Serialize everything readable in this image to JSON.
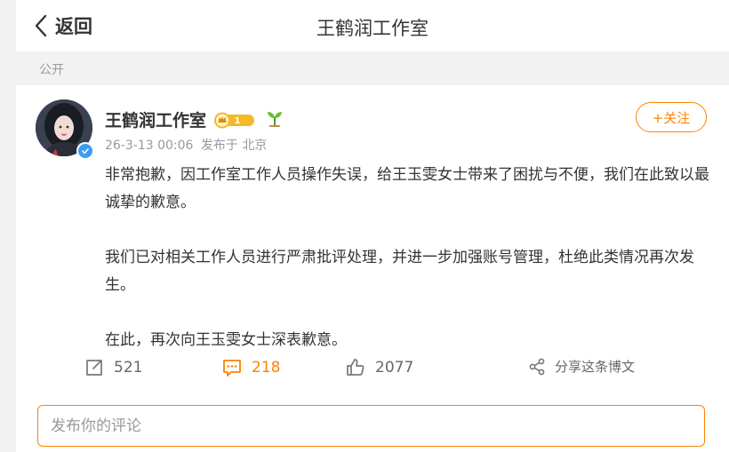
{
  "topbar": {
    "back_label": "返回",
    "title": "王鹤润工作室"
  },
  "visibility_label": "公开",
  "post": {
    "author_name": "王鹤润工作室",
    "vip_level": "1",
    "time": "26-3-13 00:06",
    "source": "发布于 北京",
    "follow_label": "+关注",
    "paragraphs": [
      "非常抱歉，因工作室工作人员操作失误，给王玉雯女士带来了困扰与不便，我们在此致以最诚挚的歉意。",
      "我们已对相关工作人员进行严肃批评处理，并进一步加强账号管理，杜绝此类情况再次发生。",
      "在此，再次向王玉雯女士深表歉意。"
    ]
  },
  "actions": {
    "repost_count": "521",
    "comment_count": "218",
    "like_count": "2077",
    "share_label": "分享这条博文"
  },
  "comment_input": {
    "placeholder": "发布你的评论"
  },
  "colors": {
    "accent": "#ff8200",
    "verified": "#3d9cf0",
    "muted": "#999999"
  }
}
